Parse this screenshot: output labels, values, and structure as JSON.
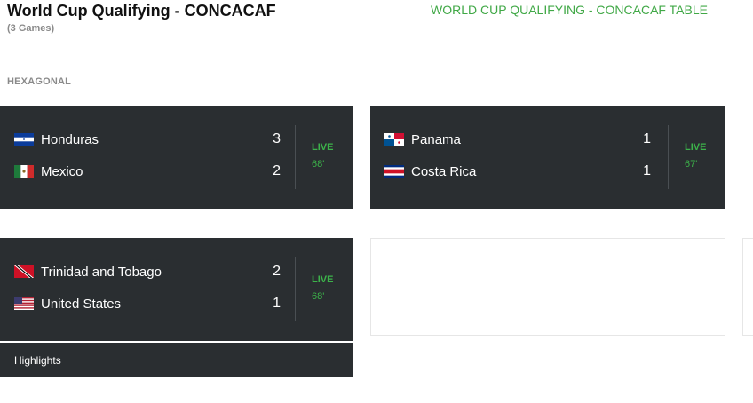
{
  "header": {
    "title": "World Cup Qualifying - CONCACAF",
    "subtitle": "(3 Games)",
    "table_link": "WORLD CUP QUALIFYING - CONCACAF TABLE"
  },
  "section": {
    "label": "HEXAGONAL"
  },
  "games": [
    {
      "teams": [
        {
          "name": "Honduras",
          "score": "3",
          "flag": "honduras-flag"
        },
        {
          "name": "Mexico",
          "score": "2",
          "flag": "mexico-flag"
        }
      ],
      "status": "LIVE",
      "clock": "68'"
    },
    {
      "teams": [
        {
          "name": "Panama",
          "score": "1",
          "flag": "panama-flag"
        },
        {
          "name": "Costa Rica",
          "score": "1",
          "flag": "costa-rica-flag"
        }
      ],
      "status": "LIVE",
      "clock": "67'"
    },
    {
      "teams": [
        {
          "name": "Trinidad and Tobago",
          "score": "2",
          "flag": "trinidad-tobago-flag"
        },
        {
          "name": "United States",
          "score": "1",
          "flag": "usa-flag"
        }
      ],
      "status": "LIVE",
      "clock": "68'"
    }
  ],
  "highlights": {
    "label": "Highlights"
  },
  "colors": {
    "card_bg": "#2a2e31",
    "live_green": "#3cb34a",
    "link_green": "#40a846"
  }
}
